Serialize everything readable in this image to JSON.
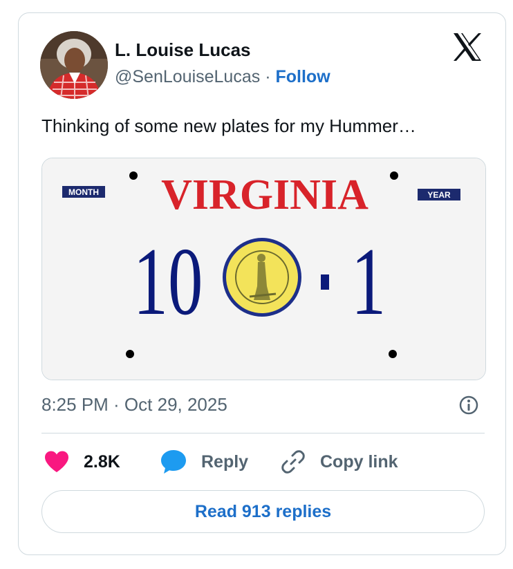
{
  "author": {
    "name": "L. Louise Lucas",
    "handle": "@SenLouiseLucas",
    "separator": "·",
    "follow_label": "Follow"
  },
  "tweet": {
    "text": "Thinking of some new plates for my Hummer…"
  },
  "plate": {
    "state": "VIRGINIA",
    "month_sticker": "MONTH",
    "year_sticker": "YEAR",
    "number_left": "10",
    "dash": "-",
    "number_right": "1"
  },
  "meta": {
    "timestamp": "8:25 PM · Oct 29, 2025"
  },
  "actions": {
    "like_count": "2.8K",
    "reply_label": "Reply",
    "copy_link_label": "Copy link",
    "read_replies_label": "Read 913 replies"
  },
  "colors": {
    "brand_blue": "#1d6fc9",
    "like_pink": "#f91880",
    "plate_red": "#d8232a",
    "plate_navy": "#0b1a7a",
    "seal_yellow": "#f3e35a"
  },
  "icons": {
    "platform": "x-logo-icon",
    "like": "heart-icon",
    "reply": "speech-bubble-icon",
    "copy_link": "link-icon",
    "info": "info-icon"
  }
}
